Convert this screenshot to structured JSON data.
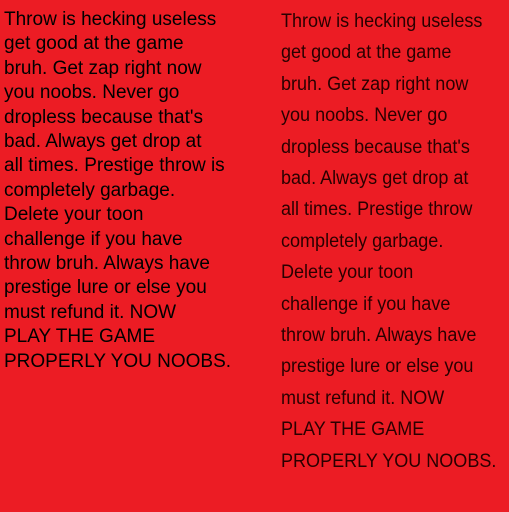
{
  "left_caption": {
    "text": "Throw is hecking useless\nget good at the game\nbruh. Get zap right now\nyou noobs. Never go\ndropless because that's\nbad. Always get drop at\nall times. Prestige throw is\ncompletely garbage.\nDelete your toon\nchallenge if you have\nthrow bruh. Always have\nprestige lure or else you\nmust refund it. NOW\nPLAY THE GAME\nPROPERLY YOU NOOBS."
  },
  "right_caption": {
    "text": "Throw is hecking useless\nget good at the game\nbruh. Get zap right now\nyou noobs. Never go\ndropless because that's\nbad. Always get drop at\nall times. Prestige throw\ncompletely garbage.\nDelete your toon\nchallenge if you have\nthrow bruh. Always have\nprestige lure or else you\nmust refund it. NOW\nPLAY THE GAME\nPROPERLY YOU NOOBS."
  },
  "colors": {
    "background": "#ec1c24",
    "left_text": "#000000",
    "right_text": "#2a0000"
  }
}
